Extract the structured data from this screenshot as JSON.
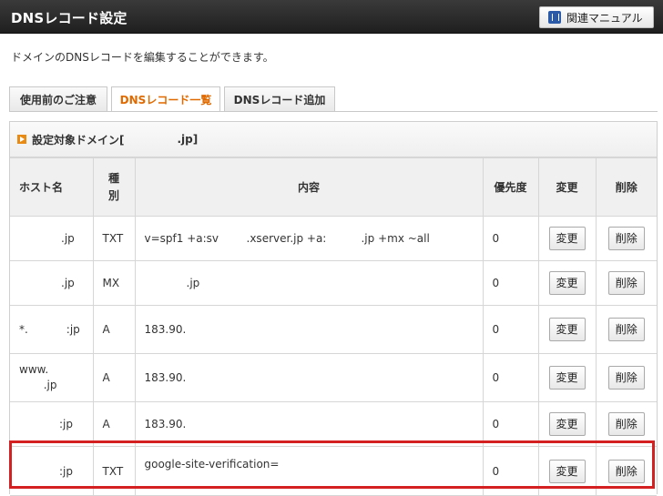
{
  "header": {
    "title": "DNSレコード設定",
    "manual_button": "関連マニュアル"
  },
  "description": "ドメインのDNSレコードを編集することができます。",
  "tabs": [
    {
      "label": "使用前のご注意",
      "active": false
    },
    {
      "label": "DNSレコード一覧",
      "active": true
    },
    {
      "label": "DNSレコード追加",
      "active": false
    }
  ],
  "domain_bar": {
    "prefix": "設定対象ドメイン[",
    "domain": ".jp]"
  },
  "table": {
    "headers": {
      "host": "ホスト名",
      "type": "種別",
      "content": "内容",
      "priority": "優先度",
      "edit": "変更",
      "delete": "削除"
    },
    "rows": [
      {
        "host": ".jp",
        "type": "TXT",
        "content": "v=spf1 +a:sv        .xserver.jp +a:          .jp +mx ~all",
        "priority": "0",
        "edit": "変更",
        "delete": "削除"
      },
      {
        "host": ".jp",
        "type": "MX",
        "content": ".jp",
        "priority": "0",
        "edit": "変更",
        "delete": "削除"
      },
      {
        "host": "*.           :jp",
        "type": "A",
        "content": "183.90.",
        "priority": "0",
        "edit": "変更",
        "delete": "削除"
      },
      {
        "host": "www.\n       .jp",
        "type": "A",
        "content": "183.90.",
        "priority": "0",
        "edit": "変更",
        "delete": "削除"
      },
      {
        "host": ":jp",
        "type": "A",
        "content": "183.90.",
        "priority": "0",
        "edit": "変更",
        "delete": "削除"
      },
      {
        "host": ":jp",
        "type": "TXT",
        "content": "google-site-verification=",
        "priority": "0",
        "edit": "変更",
        "delete": "削除"
      }
    ]
  },
  "colors": {
    "active_tab_text": "#e06a00",
    "highlight_box": "#d42020",
    "title_bar": "#2a2a2a"
  }
}
